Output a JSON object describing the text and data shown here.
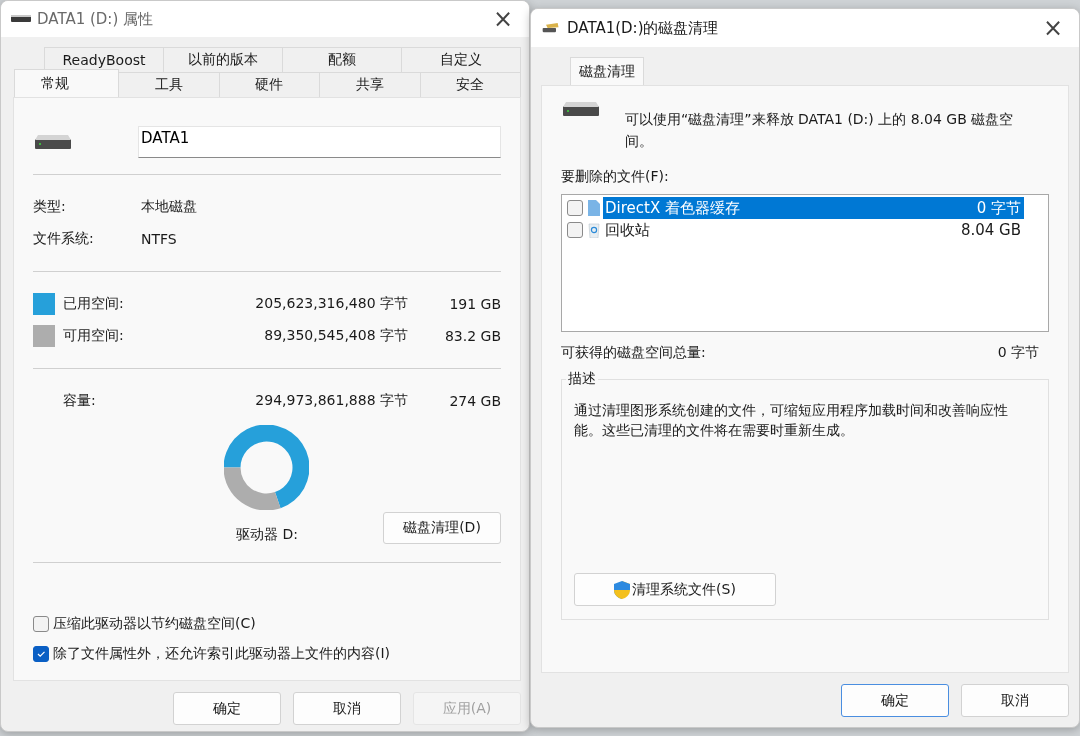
{
  "properties_window": {
    "title": "DATA1 (D:) 属性",
    "close": "×",
    "tab_rows": [
      [
        {
          "label": "ReadyBoost",
          "selected": false
        },
        {
          "label": "以前的版本",
          "selected": false
        },
        {
          "label": "配额",
          "selected": false
        },
        {
          "label": "自定义",
          "selected": false
        }
      ],
      [
        {
          "label": "常规",
          "selected": true
        },
        {
          "label": "工具",
          "selected": false
        },
        {
          "label": "硬件",
          "selected": false
        },
        {
          "label": "共享",
          "selected": false
        },
        {
          "label": "安全",
          "selected": false
        }
      ]
    ],
    "volume_name": "DATA1",
    "info": [
      {
        "label": "类型:",
        "value": "本地磁盘"
      },
      {
        "label": "文件系统:",
        "value": "NTFS"
      }
    ],
    "usage": [
      {
        "separator": ":",
        "bytes": "205,623,316,480 字节",
        "size": "191 GB",
        "color": "#26a0da"
      },
      {
        "separator": ":",
        "bytes": "89,350,545,408 字节",
        "size": "83.2 GB",
        "color": "#adadad"
      }
    ],
    "capacity": {
      "label": "容量:",
      "bytes": "294,973,861,888 字节",
      "size": "274 GB"
    },
    "chart_data": {
      "type": "donut",
      "categories": [
        "已用空间",
        "可用空间"
      ],
      "values": [
        69.7,
        30.3
      ]
    },
    "drive_label": "驱动器 D:",
    "cleanup_button": "磁盘清理(D)",
    "options": [
      {
        "label": "压缩此驱动器以节约磁盘空间(C)",
        "checked": false
      },
      {
        "label": "除了文件属性外，还允许索引此驱动器上文件的内容(I)",
        "checked": true
      }
    ],
    "buttons": [
      {
        "label": "确定",
        "disabled": false
      },
      {
        "label": "取消",
        "disabled": false
      },
      {
        "label": "应用(A)",
        "disabled": true
      }
    ]
  },
  "cleanup_window": {
    "title": "DATA1(D:)的磁盘清理",
    "close": "×",
    "tabs": [
      {
        "label": "磁盘清理",
        "selected": true
      }
    ],
    "intro": "可以使用“磁盘清理”来释放 DATA1 (D:) 上的 8.04 GB 磁盘空间。",
    "files_label": "要删除的文件(F):",
    "files": [
      {
        "kind": "file",
        "name": "DirectX 着色器缓存",
        "size": "0 字节",
        "checked": false,
        "selected": true
      },
      {
        "kind": "recycle",
        "name": "回收站",
        "size": "8.04 GB",
        "checked": false,
        "selected": false
      }
    ],
    "total_label": "可获得的磁盘空间总量:",
    "total_value": "0 字节",
    "description_title": "描述",
    "description": "通过清理图形系统创建的文件，可缩短应用程序加载时间和改善响应性能。这些已清理的文件将在需要时重新生成。",
    "system_button": "清理系统文件(S)",
    "buttons": [
      {
        "label": "确定",
        "default": true
      },
      {
        "label": "取消",
        "default": false
      }
    ]
  }
}
